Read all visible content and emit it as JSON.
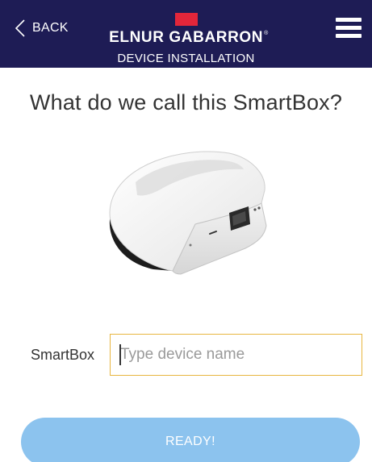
{
  "header": {
    "back_label": "BACK",
    "brand_name": "ELNUR GABARRON",
    "brand_tm": "®",
    "subtitle": "DEVICE INSTALLATION",
    "brand_color": "#e3263a",
    "background_color": "#1e1c55"
  },
  "main": {
    "title": "What do we call this SmartBox?",
    "device_image_icon": "smartbox-device-image",
    "field_label": "SmartBox",
    "name_input": {
      "value": "",
      "placeholder": "Type device name",
      "border_color": "#e8b640"
    },
    "ready_button_label": "READY!",
    "ready_button_color": "#8cc3ee"
  }
}
